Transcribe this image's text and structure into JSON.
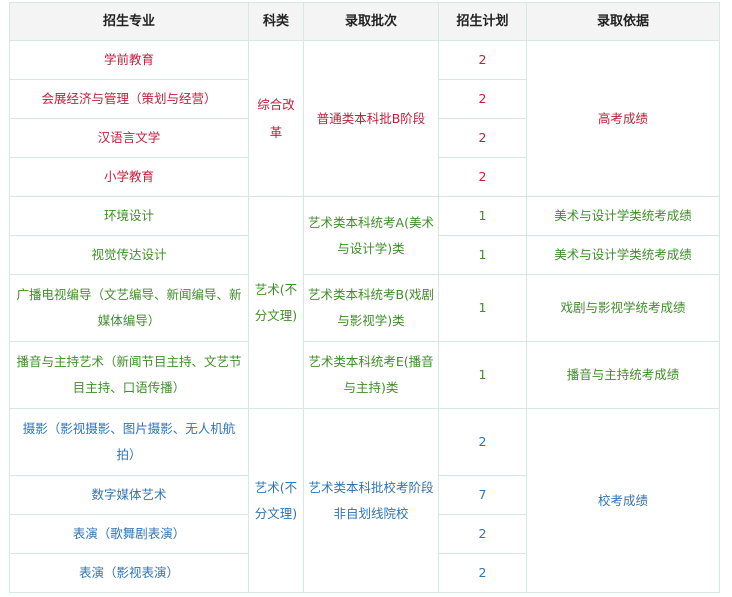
{
  "headers": [
    "招生专业",
    "科类",
    "录取批次",
    "招生计划",
    "录取依据"
  ],
  "colors": {
    "red": "#c0203c",
    "green": "#3f8e2a",
    "blue": "#2f74b5"
  },
  "groups": [
    {
      "category": "综合改革",
      "batch": "普通类本科批B阶段",
      "basis": "高考成绩",
      "majors": [
        {
          "name": "学前教育",
          "plan": "2"
        },
        {
          "name": "会展经济与管理（策划与经营）",
          "plan": "2"
        },
        {
          "name": "汉语言文学",
          "plan": "2"
        },
        {
          "name": "小学教育",
          "plan": "2"
        }
      ]
    },
    {
      "category": "艺术(不分文理)",
      "batches": [
        "艺术类本科统考A(美术与设计学)类",
        "艺术类本科统考B(戏剧与影视学)类",
        "艺术类本科统考E(播音与主持)类"
      ],
      "majors": [
        {
          "name": "环境设计",
          "plan": "1",
          "basis": "美术与设计学类统考成绩"
        },
        {
          "name": "视觉传达设计",
          "plan": "1",
          "basis": "美术与设计学类统考成绩"
        },
        {
          "name": "广播电视编导（文艺编导、新闻编导、新媒体编导）",
          "plan": "1",
          "basis": "戏剧与影视学统考成绩"
        },
        {
          "name": "播音与主持艺术（新闻节目主持、文艺节目主持、口语传播）",
          "plan": "1",
          "basis": "播音与主持统考成绩"
        }
      ]
    },
    {
      "category": "艺术(不分文理)",
      "batch": "艺术类本科批校考阶段非自划线院校",
      "basis": "校考成绩",
      "majors": [
        {
          "name": "摄影（影视摄影、图片摄影、无人机航拍）",
          "plan": "2"
        },
        {
          "name": "数字媒体艺术",
          "plan": "7"
        },
        {
          "name": "表演（歌舞剧表演）",
          "plan": "2"
        },
        {
          "name": "表演（影视表演）",
          "plan": "2"
        }
      ]
    }
  ]
}
